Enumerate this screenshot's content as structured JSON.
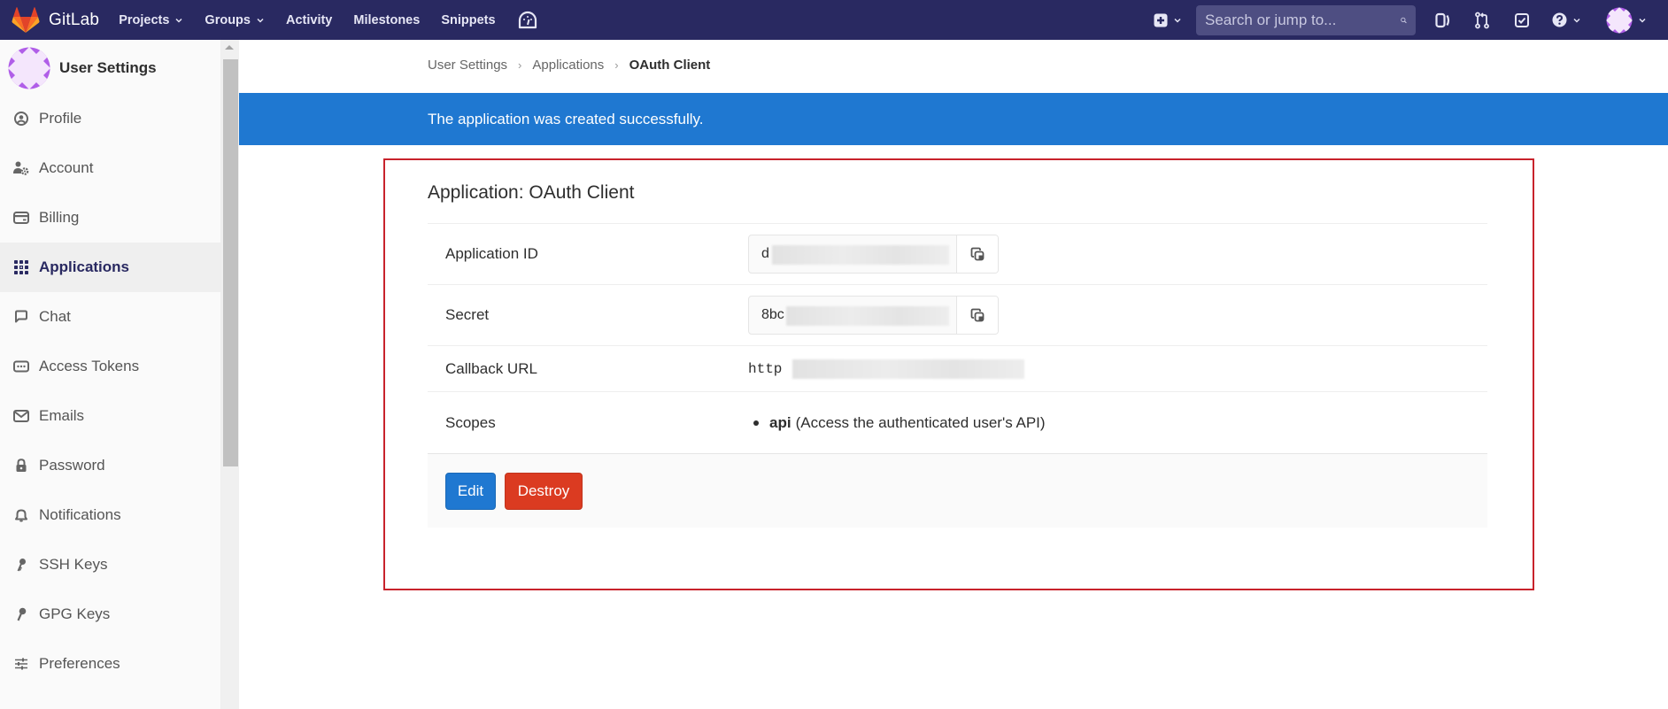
{
  "navbar": {
    "brand": "GitLab",
    "links": [
      {
        "label": "Projects",
        "dropdown": true
      },
      {
        "label": "Groups",
        "dropdown": true
      },
      {
        "label": "Activity",
        "dropdown": false
      },
      {
        "label": "Milestones",
        "dropdown": false
      },
      {
        "label": "Snippets",
        "dropdown": false
      }
    ],
    "search_placeholder": "Search or jump to...",
    "icons": [
      "dashboard-icon",
      "plus-square-icon",
      "search-icon",
      "issues-icon",
      "merge-request-icon",
      "todo-icon",
      "help-icon",
      "user-avatar"
    ]
  },
  "sidebar": {
    "title": "User Settings",
    "items": [
      {
        "label": "Profile",
        "icon": "profile-icon",
        "active": false
      },
      {
        "label": "Account",
        "icon": "account-icon",
        "active": false
      },
      {
        "label": "Billing",
        "icon": "billing-icon",
        "active": false
      },
      {
        "label": "Applications",
        "icon": "applications-icon",
        "active": true
      },
      {
        "label": "Chat",
        "icon": "chat-icon",
        "active": false
      },
      {
        "label": "Access Tokens",
        "icon": "token-icon",
        "active": false
      },
      {
        "label": "Emails",
        "icon": "email-icon",
        "active": false
      },
      {
        "label": "Password",
        "icon": "lock-icon",
        "active": false
      },
      {
        "label": "Notifications",
        "icon": "bell-icon",
        "active": false
      },
      {
        "label": "SSH Keys",
        "icon": "key-icon",
        "active": false
      },
      {
        "label": "GPG Keys",
        "icon": "key-icon",
        "active": false
      },
      {
        "label": "Preferences",
        "icon": "preferences-icon",
        "active": false
      }
    ]
  },
  "breadcrumb": {
    "items": [
      "User Settings",
      "Applications"
    ],
    "current": "OAuth Client"
  },
  "flash": {
    "message": "The application was created successfully.",
    "color": "#1f78d1"
  },
  "application": {
    "title": "Application: OAuth Client",
    "fields": {
      "application_id": {
        "label": "Application ID",
        "visible_value": "d",
        "redacted": true
      },
      "secret": {
        "label": "Secret",
        "visible_value": "8bc",
        "redacted": true
      },
      "callback_url": {
        "label": "Callback URL",
        "visible_value": "http",
        "redacted": true
      },
      "scopes": {
        "label": "Scopes",
        "items": [
          {
            "name": "api",
            "description": "(Access the authenticated user's API)"
          }
        ]
      }
    },
    "actions": {
      "edit": "Edit",
      "destroy": "Destroy"
    }
  },
  "colors": {
    "navbar": "#292961",
    "primary": "#1f78d1",
    "danger": "#db3b21",
    "highlight_outline": "#c8232c"
  }
}
